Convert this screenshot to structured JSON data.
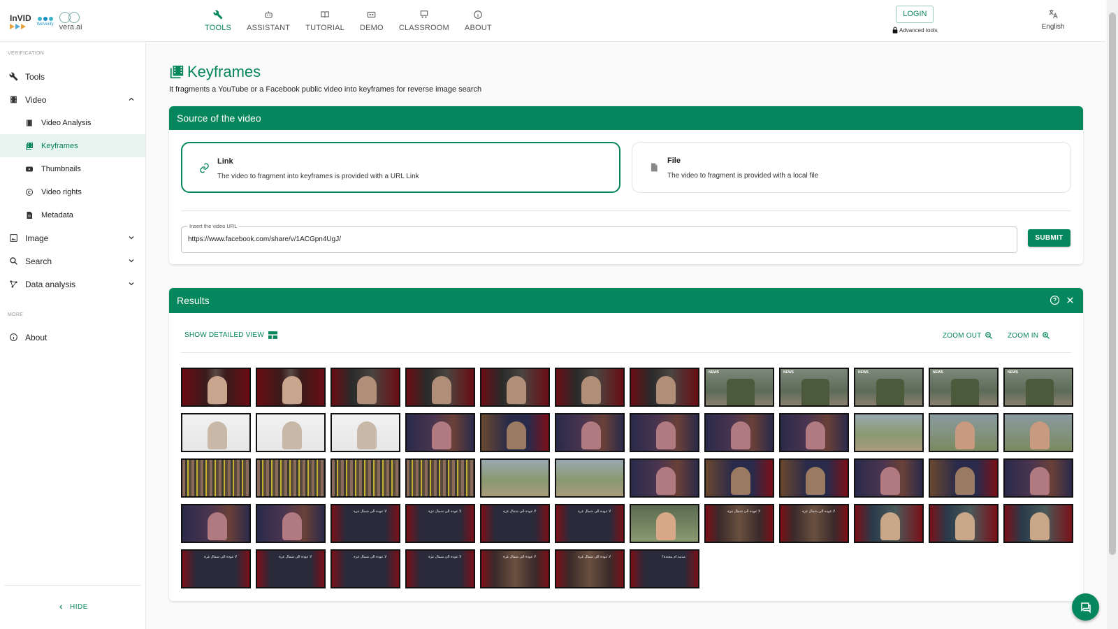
{
  "header": {
    "logos": {
      "invid": "InVID",
      "weverify": "WeVerify",
      "vera": "vera.ai"
    },
    "nav": [
      {
        "label": "TOOLS",
        "icon": "wrench-icon",
        "active": true
      },
      {
        "label": "ASSISTANT",
        "icon": "robot-icon",
        "active": false
      },
      {
        "label": "TUTORIAL",
        "icon": "book-icon",
        "active": false
      },
      {
        "label": "DEMO",
        "icon": "video-tape-icon",
        "active": false
      },
      {
        "label": "CLASSROOM",
        "icon": "classroom-icon",
        "active": false
      },
      {
        "label": "ABOUT",
        "icon": "info-icon",
        "active": false
      }
    ],
    "login_label": "LOGIN",
    "advanced_tools": "Advanced tools",
    "language": "English"
  },
  "sidebar": {
    "section_verification": "VERIFICATION",
    "items": [
      {
        "label": "Tools",
        "icon": "wrench-icon"
      },
      {
        "label": "Video",
        "icon": "film-icon",
        "expanded": true
      },
      {
        "label": "Video Analysis",
        "icon": "film-icon"
      },
      {
        "label": "Keyframes",
        "icon": "keyframes-icon",
        "active": true
      },
      {
        "label": "Thumbnails",
        "icon": "youtube-icon"
      },
      {
        "label": "Video rights",
        "icon": "copyright-icon"
      },
      {
        "label": "Metadata",
        "icon": "document-icon"
      },
      {
        "label": "Image",
        "icon": "image-icon"
      },
      {
        "label": "Search",
        "icon": "search-icon"
      },
      {
        "label": "Data analysis",
        "icon": "graph-icon"
      }
    ],
    "section_more": "MORE",
    "about": "About",
    "hide": "HIDE"
  },
  "main": {
    "title": "Keyframes",
    "description": "It fragments a YouTube or a Facebook public video into keyframes for reverse image search",
    "source": {
      "header": "Source of the video",
      "link": {
        "title": "Link",
        "desc": "The video to fragment into keyframes is provided with a URL Link"
      },
      "file": {
        "title": "File",
        "desc": "The video to fragment is provided with a local file"
      },
      "url_label": "Insert the video URL",
      "url_value": "https://www.facebook.com/share/v/1ACGpn4UgJ/",
      "submit": "SUBMIT"
    },
    "results": {
      "header": "Results",
      "detailed_view": "SHOW DETAILED VIEW",
      "zoom_out": "ZOOM OUT",
      "zoom_in": "ZOOM IN",
      "thumbnail_count_visible": 55,
      "thumb_text": {
        "news": "NEWS",
        "headline": "لا عودة الى شمال غزة",
        "headline2": "مدنية أم مجندة؟"
      }
    }
  },
  "colors": {
    "primary": "#06865c",
    "frame_red": "#7a1018"
  }
}
